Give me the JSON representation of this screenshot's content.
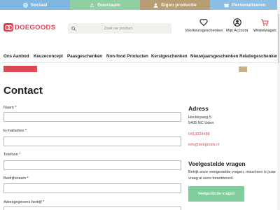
{
  "topbar": {
    "items": [
      {
        "label": "Sociaal",
        "icon": "globe-icon",
        "color": "#7fb7e3"
      },
      {
        "label": "Duurzaam",
        "icon": "recycle-icon",
        "color": "#8fcfa1"
      },
      {
        "label": "Eigen productie",
        "icon": "person-icon",
        "color": "#b89c72"
      },
      {
        "label": "Personaliseren",
        "icon": "gift-icon",
        "color": "#8bbfe6"
      }
    ]
  },
  "header": {
    "logo_text": "DOEGOODS",
    "brand_color": "#e0414e",
    "search_placeholder": "Zoek uw product",
    "wishlist_label": "Voorkeursgeschenken",
    "account_label": "Mijn Account",
    "cart_label": "Winkelwagen"
  },
  "nav": {
    "items": [
      "Ons Aanbod",
      "Keuzeconcept",
      "Paasgeschenken",
      "Non-food Producten",
      "Kerstgeschenken",
      "Nieuwjaarsgeschenken",
      "Relatiegeschenken"
    ]
  },
  "main": {
    "title": "Contact",
    "fields": [
      {
        "label": "Naam",
        "required": "*"
      },
      {
        "label": "E-mailadres",
        "required": "*"
      },
      {
        "label": "Telefoon",
        "required": "*"
      },
      {
        "label": "Bedrijfsnaam",
        "required": "*"
      },
      {
        "label": "Adresgegevens bedrijf",
        "required": "*"
      }
    ]
  },
  "sidebar": {
    "adress_title": "Adress",
    "street": "Hockeyweg 5",
    "city": "5405 NC Uden",
    "phone": "0413334488",
    "email": "info@doegoods.nl",
    "faq_title": "Veelgestelde vragen",
    "faq_text": "Bekijk onze veelgestelde vragen, misschien is jouw vraag al eens beantwoord.",
    "faq_button": "Veelgestelde vragen",
    "accent_color": "#80cc9c"
  }
}
